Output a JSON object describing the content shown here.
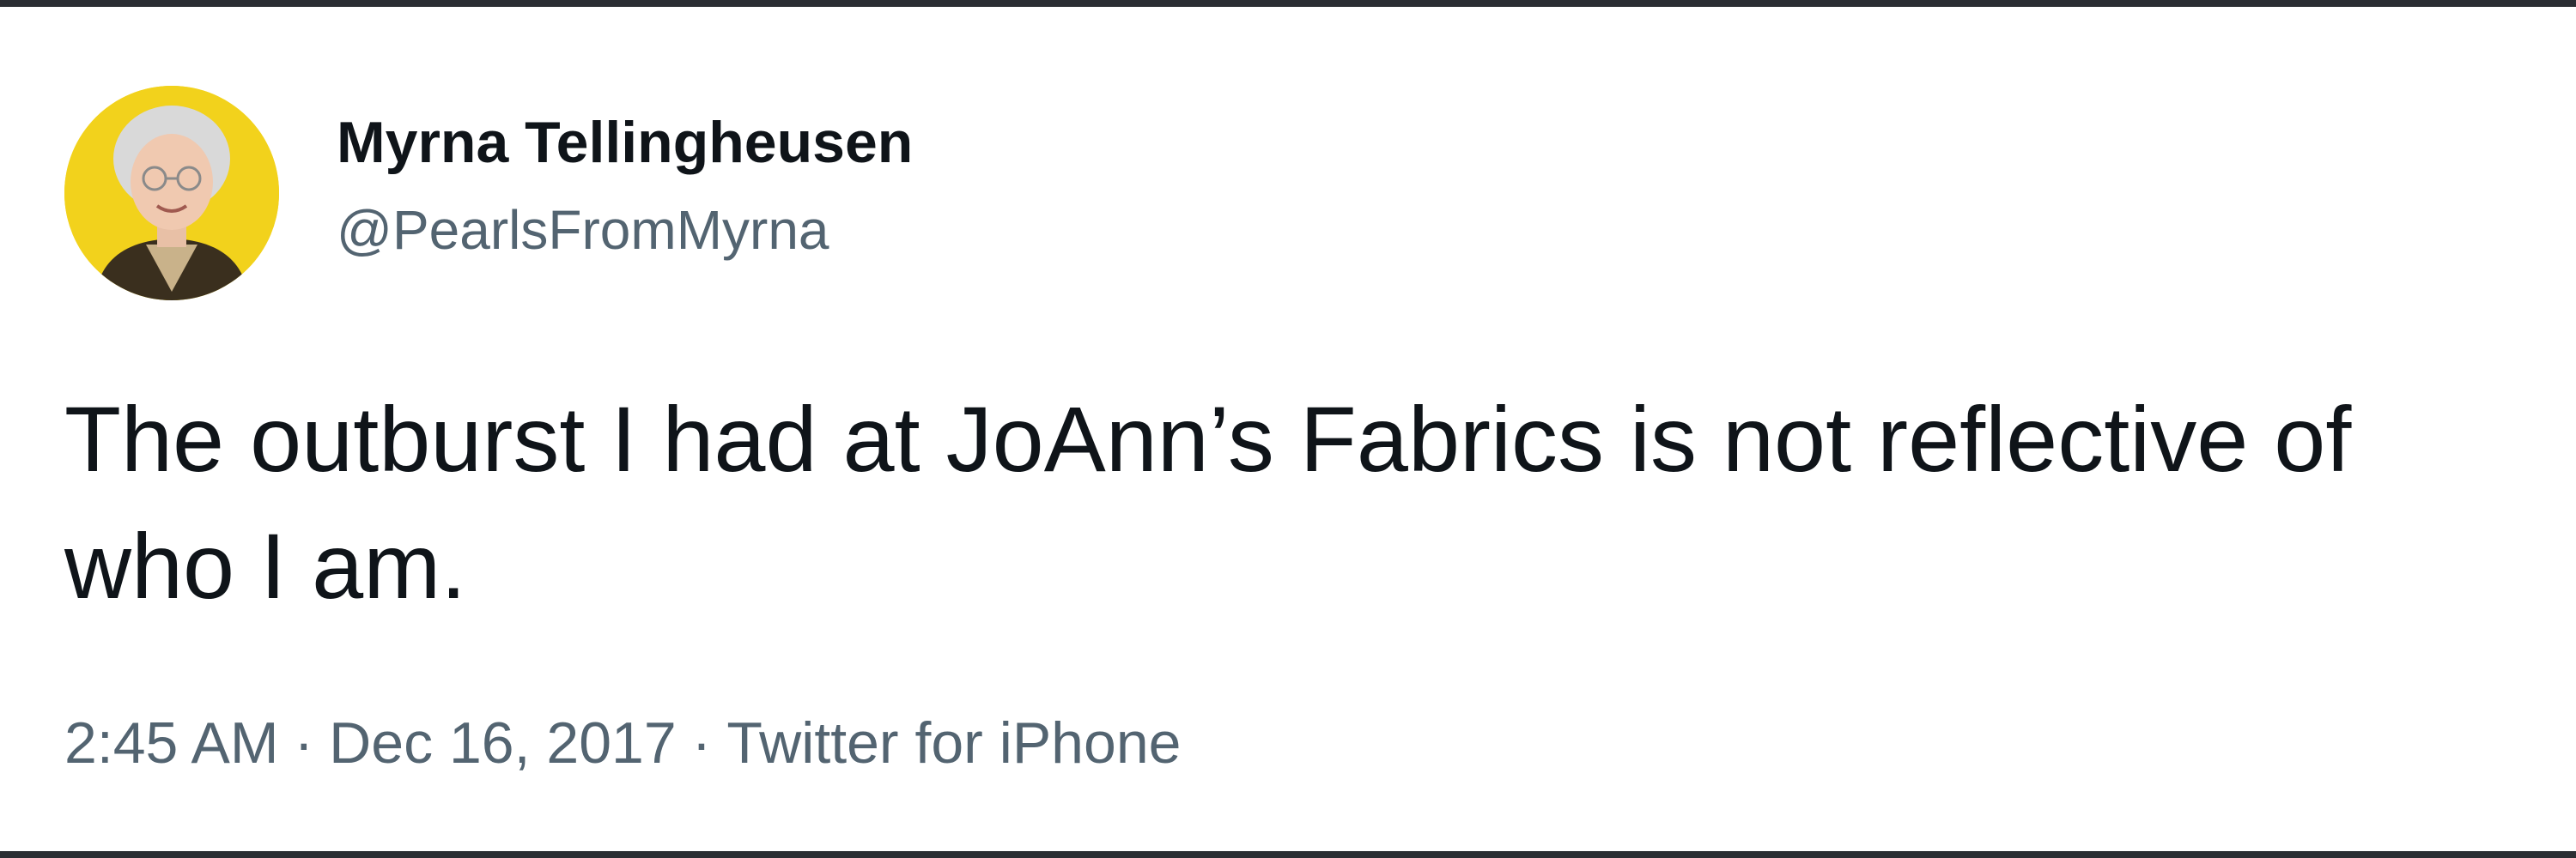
{
  "tweet": {
    "author": {
      "display_name": "Myrna Tellingheusen",
      "handle": "@PearlsFromMyrna",
      "avatar_icon": "profile-photo"
    },
    "text": "The outburst I had at JoAnn’s Fabrics is not reflective of who I am.",
    "time": "2:45 AM",
    "date": "Dec 16, 2017",
    "source": "Twitter for iPhone",
    "separator": "·"
  },
  "colors": {
    "background": "#ffffff",
    "frame": "#2b2e33",
    "text_primary": "#0f1419",
    "text_secondary": "#536471",
    "avatar_background": "#f2d21c"
  }
}
